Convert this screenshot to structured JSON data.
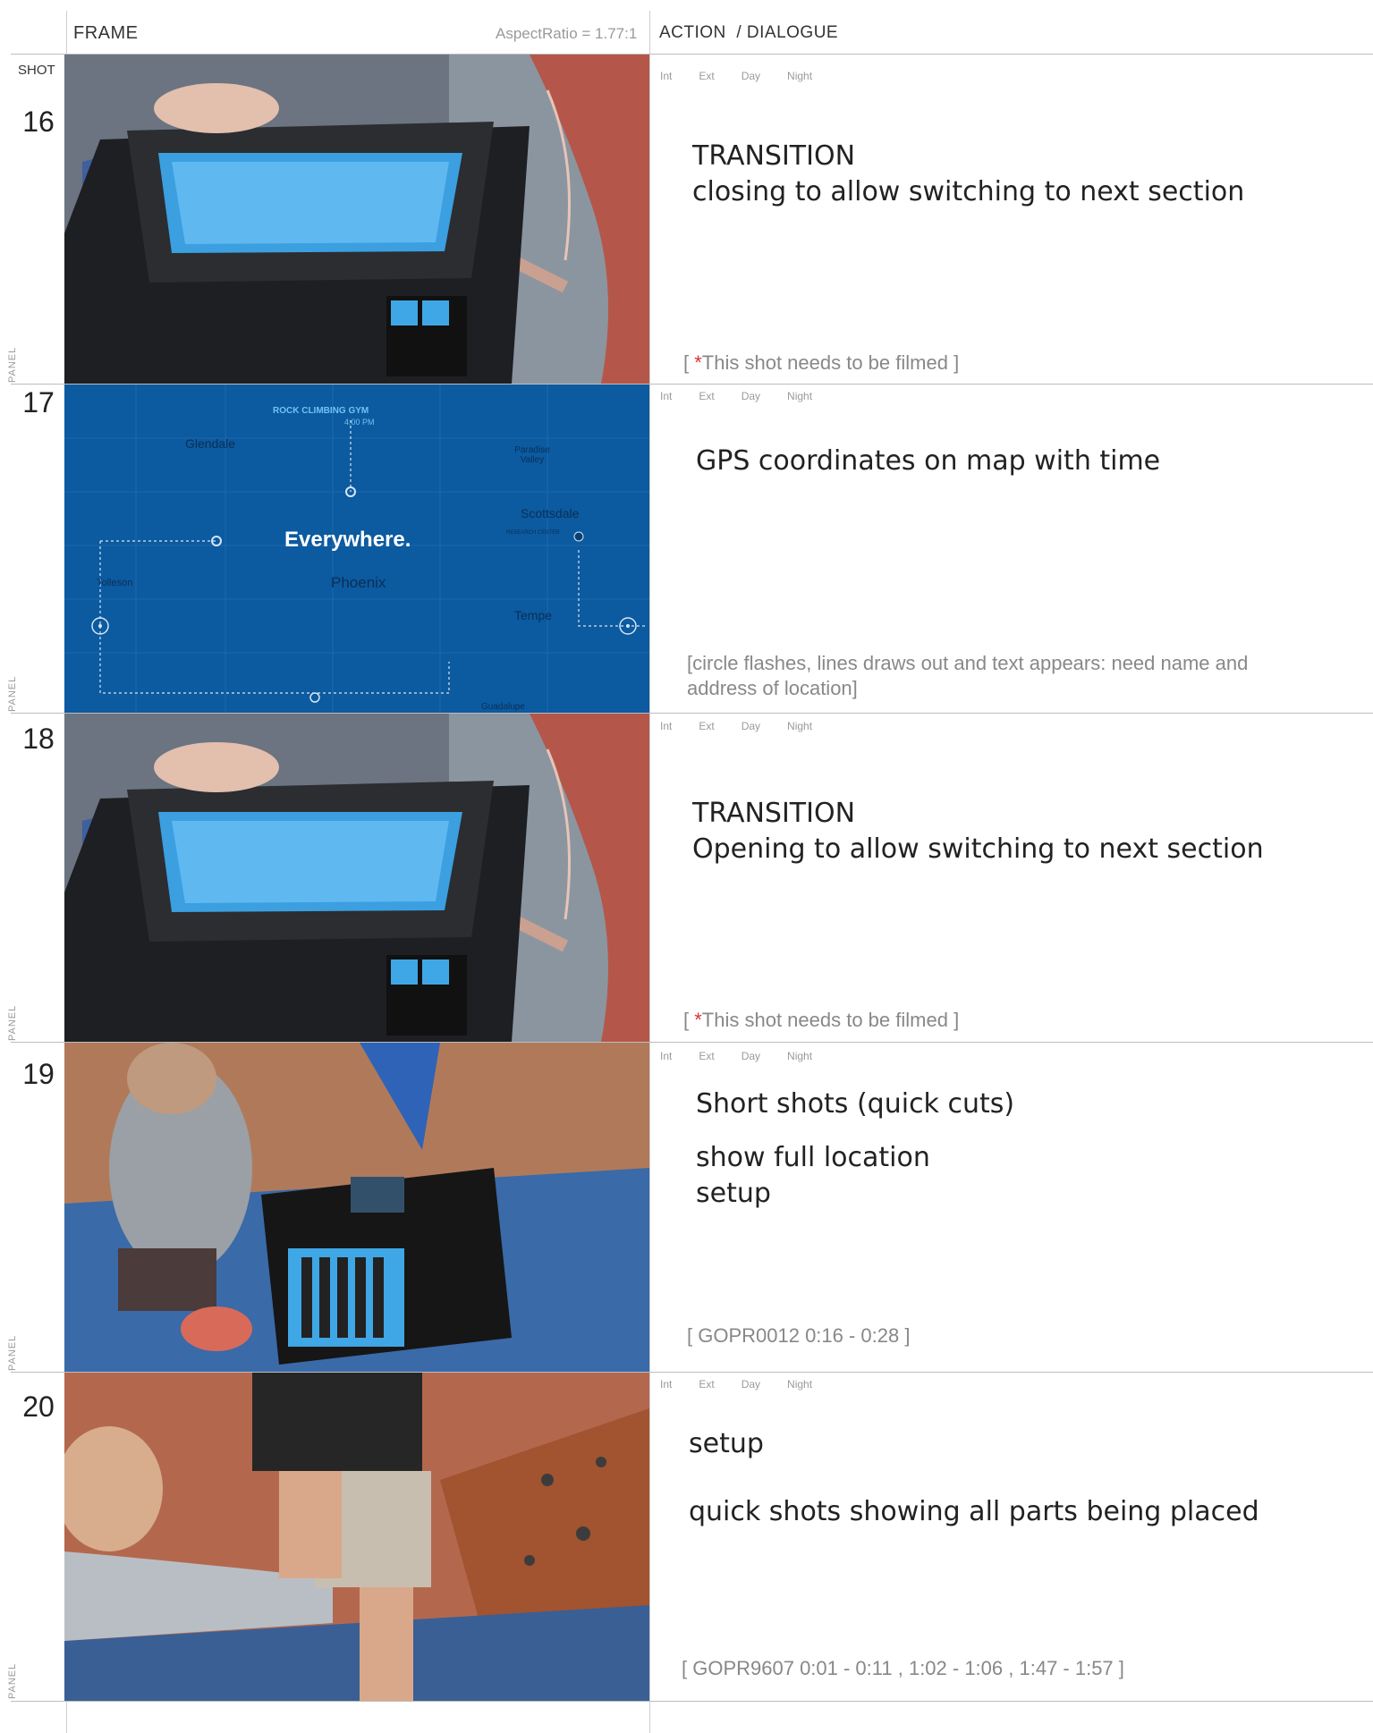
{
  "header": {
    "frame_label": "FRAME",
    "aspect_ratio": "AspectRatio = 1.77:1",
    "action_label": "ACTION  / DIALOGUE",
    "shot_label": "SHOT"
  },
  "panel_label": "PANEL",
  "scene_tags": [
    "Int",
    "Ext",
    "Day",
    "Night"
  ],
  "colors": {
    "accent_red": "#d73535",
    "map_blue": "#0c5aa0",
    "case_blue": "#3fa7e6"
  },
  "shots": [
    {
      "number": "16",
      "image": "equipment-case-closing",
      "action_lines": [
        "TRANSITION",
        "closing to allow switching to next section"
      ],
      "note_marker": "*",
      "note_text": "This shot needs to be filmed"
    },
    {
      "number": "17",
      "image": "map-gps-animation",
      "map_labels": {
        "headline": "Everywhere.",
        "gym": "ROCK CLIMBING GYM",
        "time": "4:00 PM",
        "research": "RESEARCH CENTER",
        "glendale": "Glendale",
        "paradise": "Paradise Valley",
        "scottsdale": "Scottsdale",
        "phoenix": "Phoenix",
        "tolleson": "Tolleson",
        "tempe": "Tempe",
        "guadalupe": "Guadalupe"
      },
      "action_lines": [
        "GPS coordinates on map with time"
      ],
      "note_text": "[circle flashes, lines draws out and text appears: need name and address of location]"
    },
    {
      "number": "18",
      "image": "equipment-case-opening",
      "action_lines": [
        "TRANSITION",
        "Opening to allow switching to next section"
      ],
      "note_marker": "*",
      "note_text": "This shot needs to be filmed"
    },
    {
      "number": "19",
      "image": "climbing-gym-setup",
      "action_lines": [
        "Short shots (quick cuts)",
        "show full location",
        "setup"
      ],
      "note_text": "[ GOPR0012 0:16 - 0:28 ]"
    },
    {
      "number": "20",
      "image": "placing-sensors",
      "action_lines": [
        "setup",
        "quick shots showing all parts being placed"
      ],
      "note_text": "[ GOPR9607 0:01 - 0:11 , 1:02 - 1:06 , 1:47 - 1:57 ]"
    }
  ]
}
